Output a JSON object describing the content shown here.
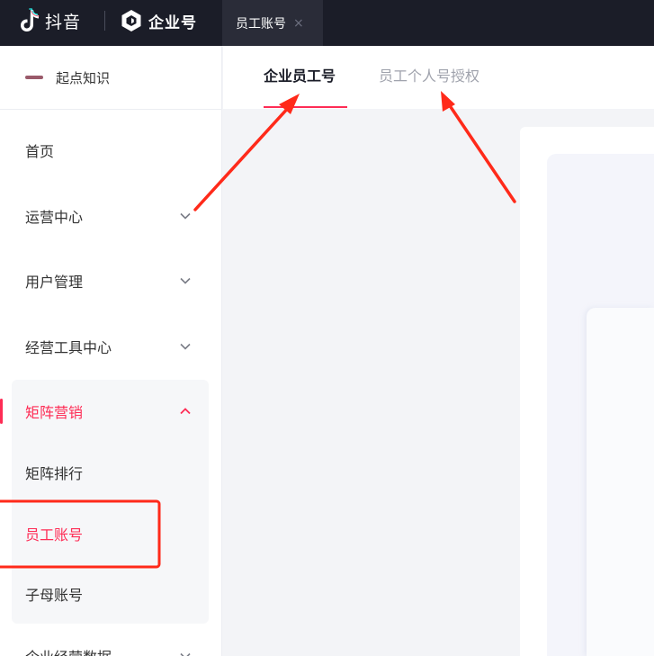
{
  "topbar": {
    "brand_label": "抖音",
    "product_label": "企业号",
    "open_tab_label": "员工账号",
    "open_tab_close": "×",
    "brand_logo_icon": "douyin-note-icon",
    "product_logo_icon": "enterprise-hexagon-icon"
  },
  "sidebar": {
    "org_name": "起点知识",
    "items": [
      {
        "label": "首页"
      },
      {
        "label": "运营中心",
        "expandable": true
      },
      {
        "label": "用户管理",
        "expandable": true
      },
      {
        "label": "经营工具中心",
        "expandable": true
      },
      {
        "label": "矩阵营销",
        "expandable": true,
        "expanded": true
      },
      {
        "label": "矩阵排行"
      },
      {
        "label": "员工账号",
        "current": true
      },
      {
        "label": "子母账号"
      },
      {
        "label": "企业经营数据",
        "expandable": true
      }
    ]
  },
  "content": {
    "tabs": [
      {
        "label": "企业员工号",
        "active": true
      },
      {
        "label": "员工个人号授权",
        "active": false
      }
    ]
  },
  "colors": {
    "accent": "#fe2c55",
    "topbar_bg": "#1b1d28",
    "annotation_red": "#ff2a1a"
  }
}
